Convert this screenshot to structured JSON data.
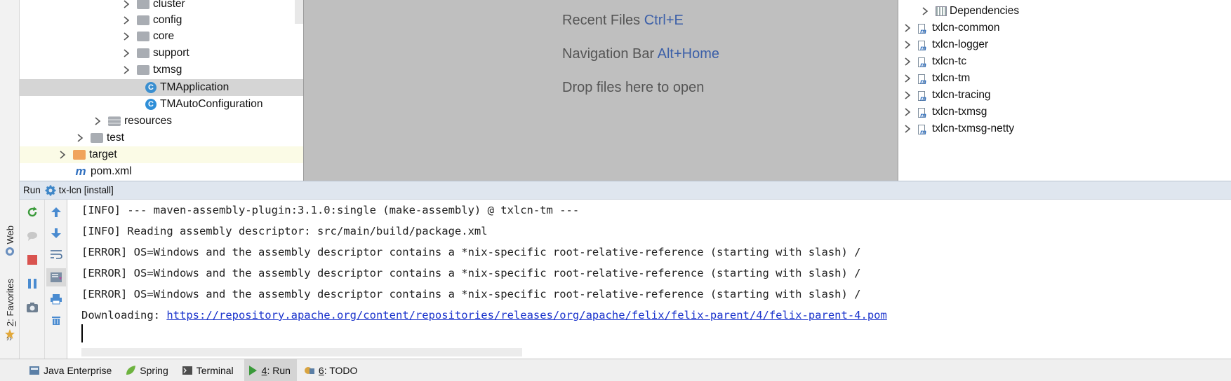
{
  "left_stripe": {
    "web_label": "Web",
    "favorites_number": "2",
    "favorites_label": "Favorites",
    "more": "››"
  },
  "project_tree": {
    "rows": [
      {
        "label": "cluster",
        "kind": "folder"
      },
      {
        "label": "config",
        "kind": "folder"
      },
      {
        "label": "core",
        "kind": "folder"
      },
      {
        "label": "support",
        "kind": "folder"
      },
      {
        "label": "txmsg",
        "kind": "folder"
      },
      {
        "label": "TMApplication",
        "kind": "spring-class",
        "selected": true
      },
      {
        "label": "TMAutoConfiguration",
        "kind": "class"
      },
      {
        "label": "resources",
        "kind": "resources-folder"
      },
      {
        "label": "test",
        "kind": "folder"
      },
      {
        "label": "target",
        "kind": "excluded-folder"
      },
      {
        "label": "pom.xml",
        "kind": "maven-file"
      }
    ]
  },
  "editor": {
    "hints": [
      {
        "text": "Recent Files",
        "shortcut": "Ctrl+E"
      },
      {
        "text": "Navigation Bar",
        "shortcut": "Alt+Home"
      },
      {
        "text": "Drop files here to open",
        "shortcut": ""
      }
    ]
  },
  "maven": {
    "dependencies_label": "Dependencies",
    "modules": [
      "txlcn-common",
      "txlcn-logger",
      "txlcn-tc",
      "txlcn-tm",
      "txlcn-tracing",
      "txlcn-txmsg",
      "txlcn-txmsg-netty"
    ]
  },
  "run": {
    "title": "Run",
    "config_name": "tx-lcn [install]",
    "console_lines": [
      "[INFO] --- maven-assembly-plugin:3.1.0:single (make-assembly) @ txlcn-tm ---",
      "[INFO] Reading assembly descriptor: src/main/build/package.xml",
      "[ERROR] OS=Windows and the assembly descriptor contains a *nix-specific root-relative-reference (starting with slash) /",
      "[ERROR] OS=Windows and the assembly descriptor contains a *nix-specific root-relative-reference (starting with slash) /",
      "[ERROR] OS=Windows and the assembly descriptor contains a *nix-specific root-relative-reference (starting with slash) /"
    ],
    "download_prefix": "Downloading: ",
    "download_url": "https://repository.apache.org/content/repositories/releases/org/apache/felix/felix-parent/4/felix-parent-4.pom"
  },
  "bottom_tabs": {
    "java_enterprise": "Java Enterprise",
    "spring": "Spring",
    "terminal": "Terminal",
    "run_number": "4",
    "run_label": ": Run",
    "todo_number": "6",
    "todo_label": ": TODO"
  },
  "colors": {
    "accent_blue": "#3b5fa8",
    "link": "#1a33cc",
    "selected_row": "#d5d5d5"
  }
}
